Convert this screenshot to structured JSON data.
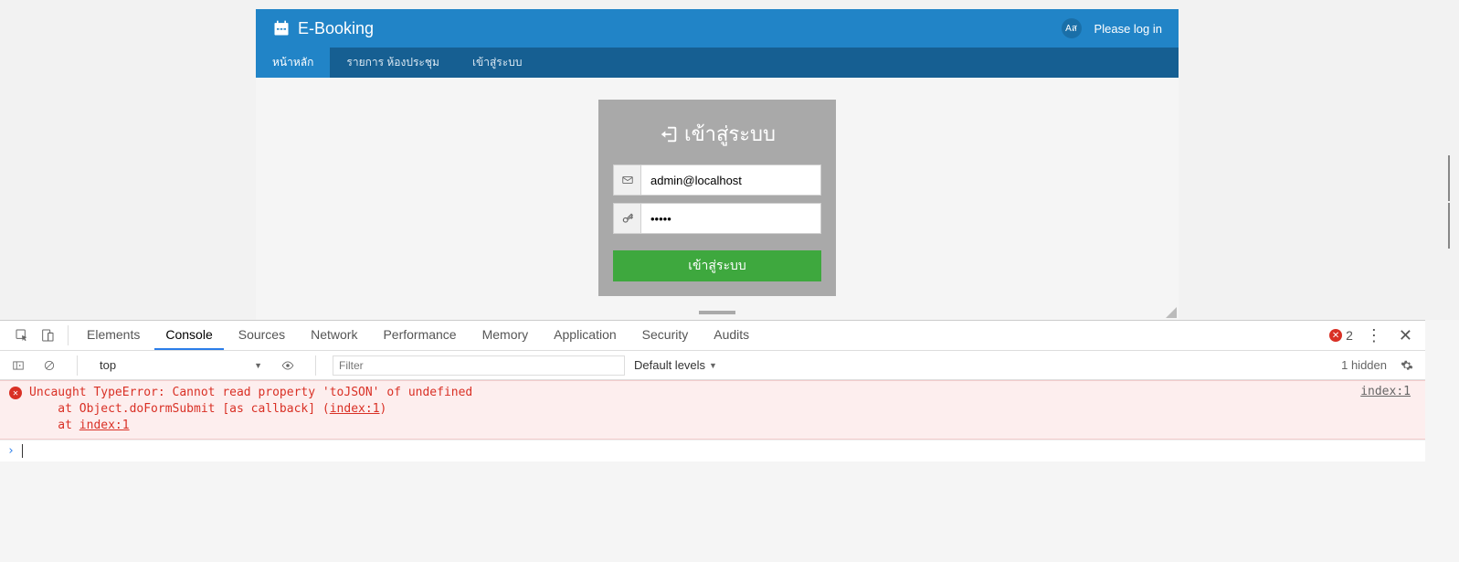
{
  "header": {
    "brand": "E-Booking",
    "langBadge": "Aส",
    "loginText": "Please log in"
  },
  "nav": {
    "items": [
      {
        "label": "หน้าหลัก",
        "active": true
      },
      {
        "label": "รายการ ห้องประชุม",
        "active": false
      },
      {
        "label": "เข้าสู่ระบบ",
        "active": false
      }
    ]
  },
  "loginCard": {
    "title": "เข้าสู่ระบบ",
    "emailValue": "admin@localhost",
    "passwordValue": "•••••",
    "buttonLabel": "เข้าสู่ระบบ"
  },
  "devtools": {
    "tabs": [
      "Elements",
      "Console",
      "Sources",
      "Network",
      "Performance",
      "Memory",
      "Application",
      "Security",
      "Audits"
    ],
    "activeTab": "Console",
    "errorCount": "2",
    "context": "top",
    "filterPlaceholder": "Filter",
    "levelsLabel": "Default levels",
    "hiddenLabel": "1 hidden",
    "error": {
      "line1": "Uncaught TypeError: Cannot read property 'toJSON' of undefined",
      "line2a": "    at Object.doFormSubmit [as callback] (",
      "line2link": "index:1",
      "line2b": ")",
      "line3a": "    at ",
      "line3link": "index:1",
      "source": "index:1"
    }
  }
}
